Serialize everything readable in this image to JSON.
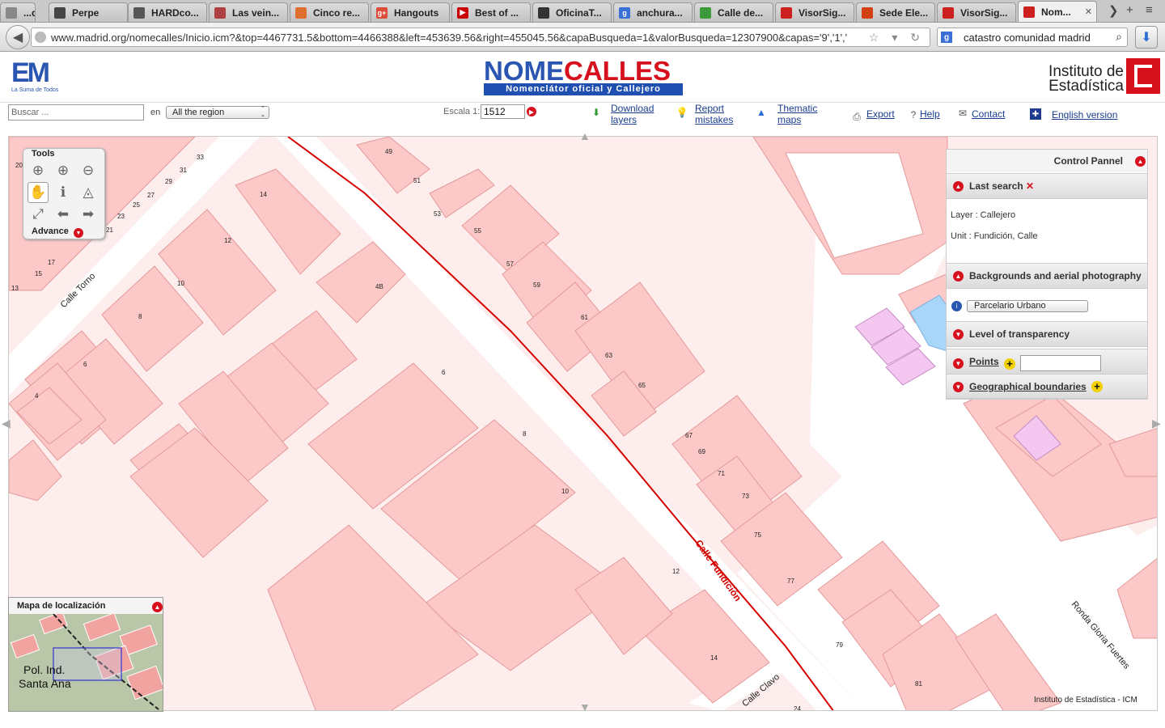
{
  "browser": {
    "tabs": [
      {
        "label": "...d...",
        "color": "#888888",
        "icon_letter": ""
      },
      {
        "label": "Perpe",
        "color": "#444444",
        "icon_letter": ""
      },
      {
        "label": "HARDco...",
        "color": "#555555",
        "icon_letter": ""
      },
      {
        "label": "Las vein...",
        "color": "#b04040",
        "icon_letter": ""
      },
      {
        "label": "Cinco re...",
        "color": "#e07030",
        "icon_letter": ""
      },
      {
        "label": "Hangouts",
        "color": "#dd4b39",
        "icon_letter": "g+"
      },
      {
        "label": "Best of ...",
        "color": "#cc0000",
        "icon_letter": "▶"
      },
      {
        "label": "OficinaT...",
        "color": "#333333",
        "icon_letter": ""
      },
      {
        "label": "anchura...",
        "color": "#3a6fd8",
        "icon_letter": "g"
      },
      {
        "label": "Calle de...",
        "color": "#3a9a3a",
        "icon_letter": ""
      },
      {
        "label": "VisorSig...",
        "color": "#cc2020",
        "icon_letter": ""
      },
      {
        "label": "Sede Ele...",
        "color": "#d04010",
        "icon_letter": ""
      },
      {
        "label": "VisorSig...",
        "color": "#cc2020",
        "icon_letter": ""
      },
      {
        "label": "Nom...",
        "color": "#cc2020",
        "icon_letter": ""
      }
    ],
    "url": "www.madrid.org/nomecalles/Inicio.icm?&top=4467731.5&bottom=4466388&left=453639.56&right=455045.56&capaBusqueda=1&valorBusqueda=12307900&capas='9','1','",
    "search_query": "catastro comunidad madrid"
  },
  "header": {
    "left_logo_text": "EM",
    "left_logo_sub": "La Suma de Todos",
    "center_logo_a": "NOME",
    "center_logo_b": "CALLES",
    "center_logo_bar": "Nomenclátor oficial y Callejero",
    "right_logo_line1": "Instituto de",
    "right_logo_line2": "Estadística"
  },
  "toolbar": {
    "search_placeholder": "Buscar ...",
    "en_label": "en",
    "region_value": "All the region",
    "escala_label": "Escala 1:",
    "escala_value": "1512",
    "links": {
      "download_1": "Download",
      "download_2": "layers",
      "report_1": "Report",
      "report_2": "mistakes",
      "thematic_1": "Thematic",
      "thematic_2": "maps",
      "export": "Export",
      "help": "Help",
      "contact": "Contact",
      "english": "English version"
    }
  },
  "tools": {
    "title": "Tools",
    "advance": "Advance"
  },
  "control_panel": {
    "title": "Control Pannel",
    "last_search": "Last search",
    "layer": "Layer : Callejero",
    "unit": "Unit : Fundición, Calle",
    "backgrounds": "Backgrounds and aerial photography",
    "background_value": "Parcelario Urbano",
    "transparency": "Level of transparency",
    "points": "Points",
    "boundaries": "Geographical boundaries"
  },
  "locator": {
    "title": "Mapa de localización",
    "label_1": "Pol. Ind.",
    "label_2": "Santa Ana"
  },
  "map": {
    "streets": {
      "torno": "Calle Torno",
      "fundicion": "Calle Fundición",
      "clavo": "Calle Clavo",
      "ronda": "Ronda Gloria Fuertes"
    },
    "numbers_left": [
      "20",
      "33",
      "31",
      "29",
      "27",
      "25",
      "23",
      "21",
      "17",
      "15",
      "13",
      "4",
      "6",
      "8",
      "10",
      "12",
      "14"
    ],
    "numbers_mid": [
      "49",
      "51",
      "53",
      "55",
      "57",
      "59",
      "4B",
      "6",
      "8",
      "10",
      "12",
      "14"
    ],
    "numbers_right": [
      "61",
      "63",
      "65",
      "67",
      "69",
      "71",
      "73",
      "75",
      "77",
      "79",
      "81",
      "24"
    ],
    "copyright": "Instituto de Estadística - ICM"
  },
  "colors": {
    "parcel": "#fcc8c8",
    "parcel_stroke": "#e39a9a",
    "street_line": "#d60000",
    "accent": "#d6101d",
    "brand_blue": "#2a55b0"
  }
}
